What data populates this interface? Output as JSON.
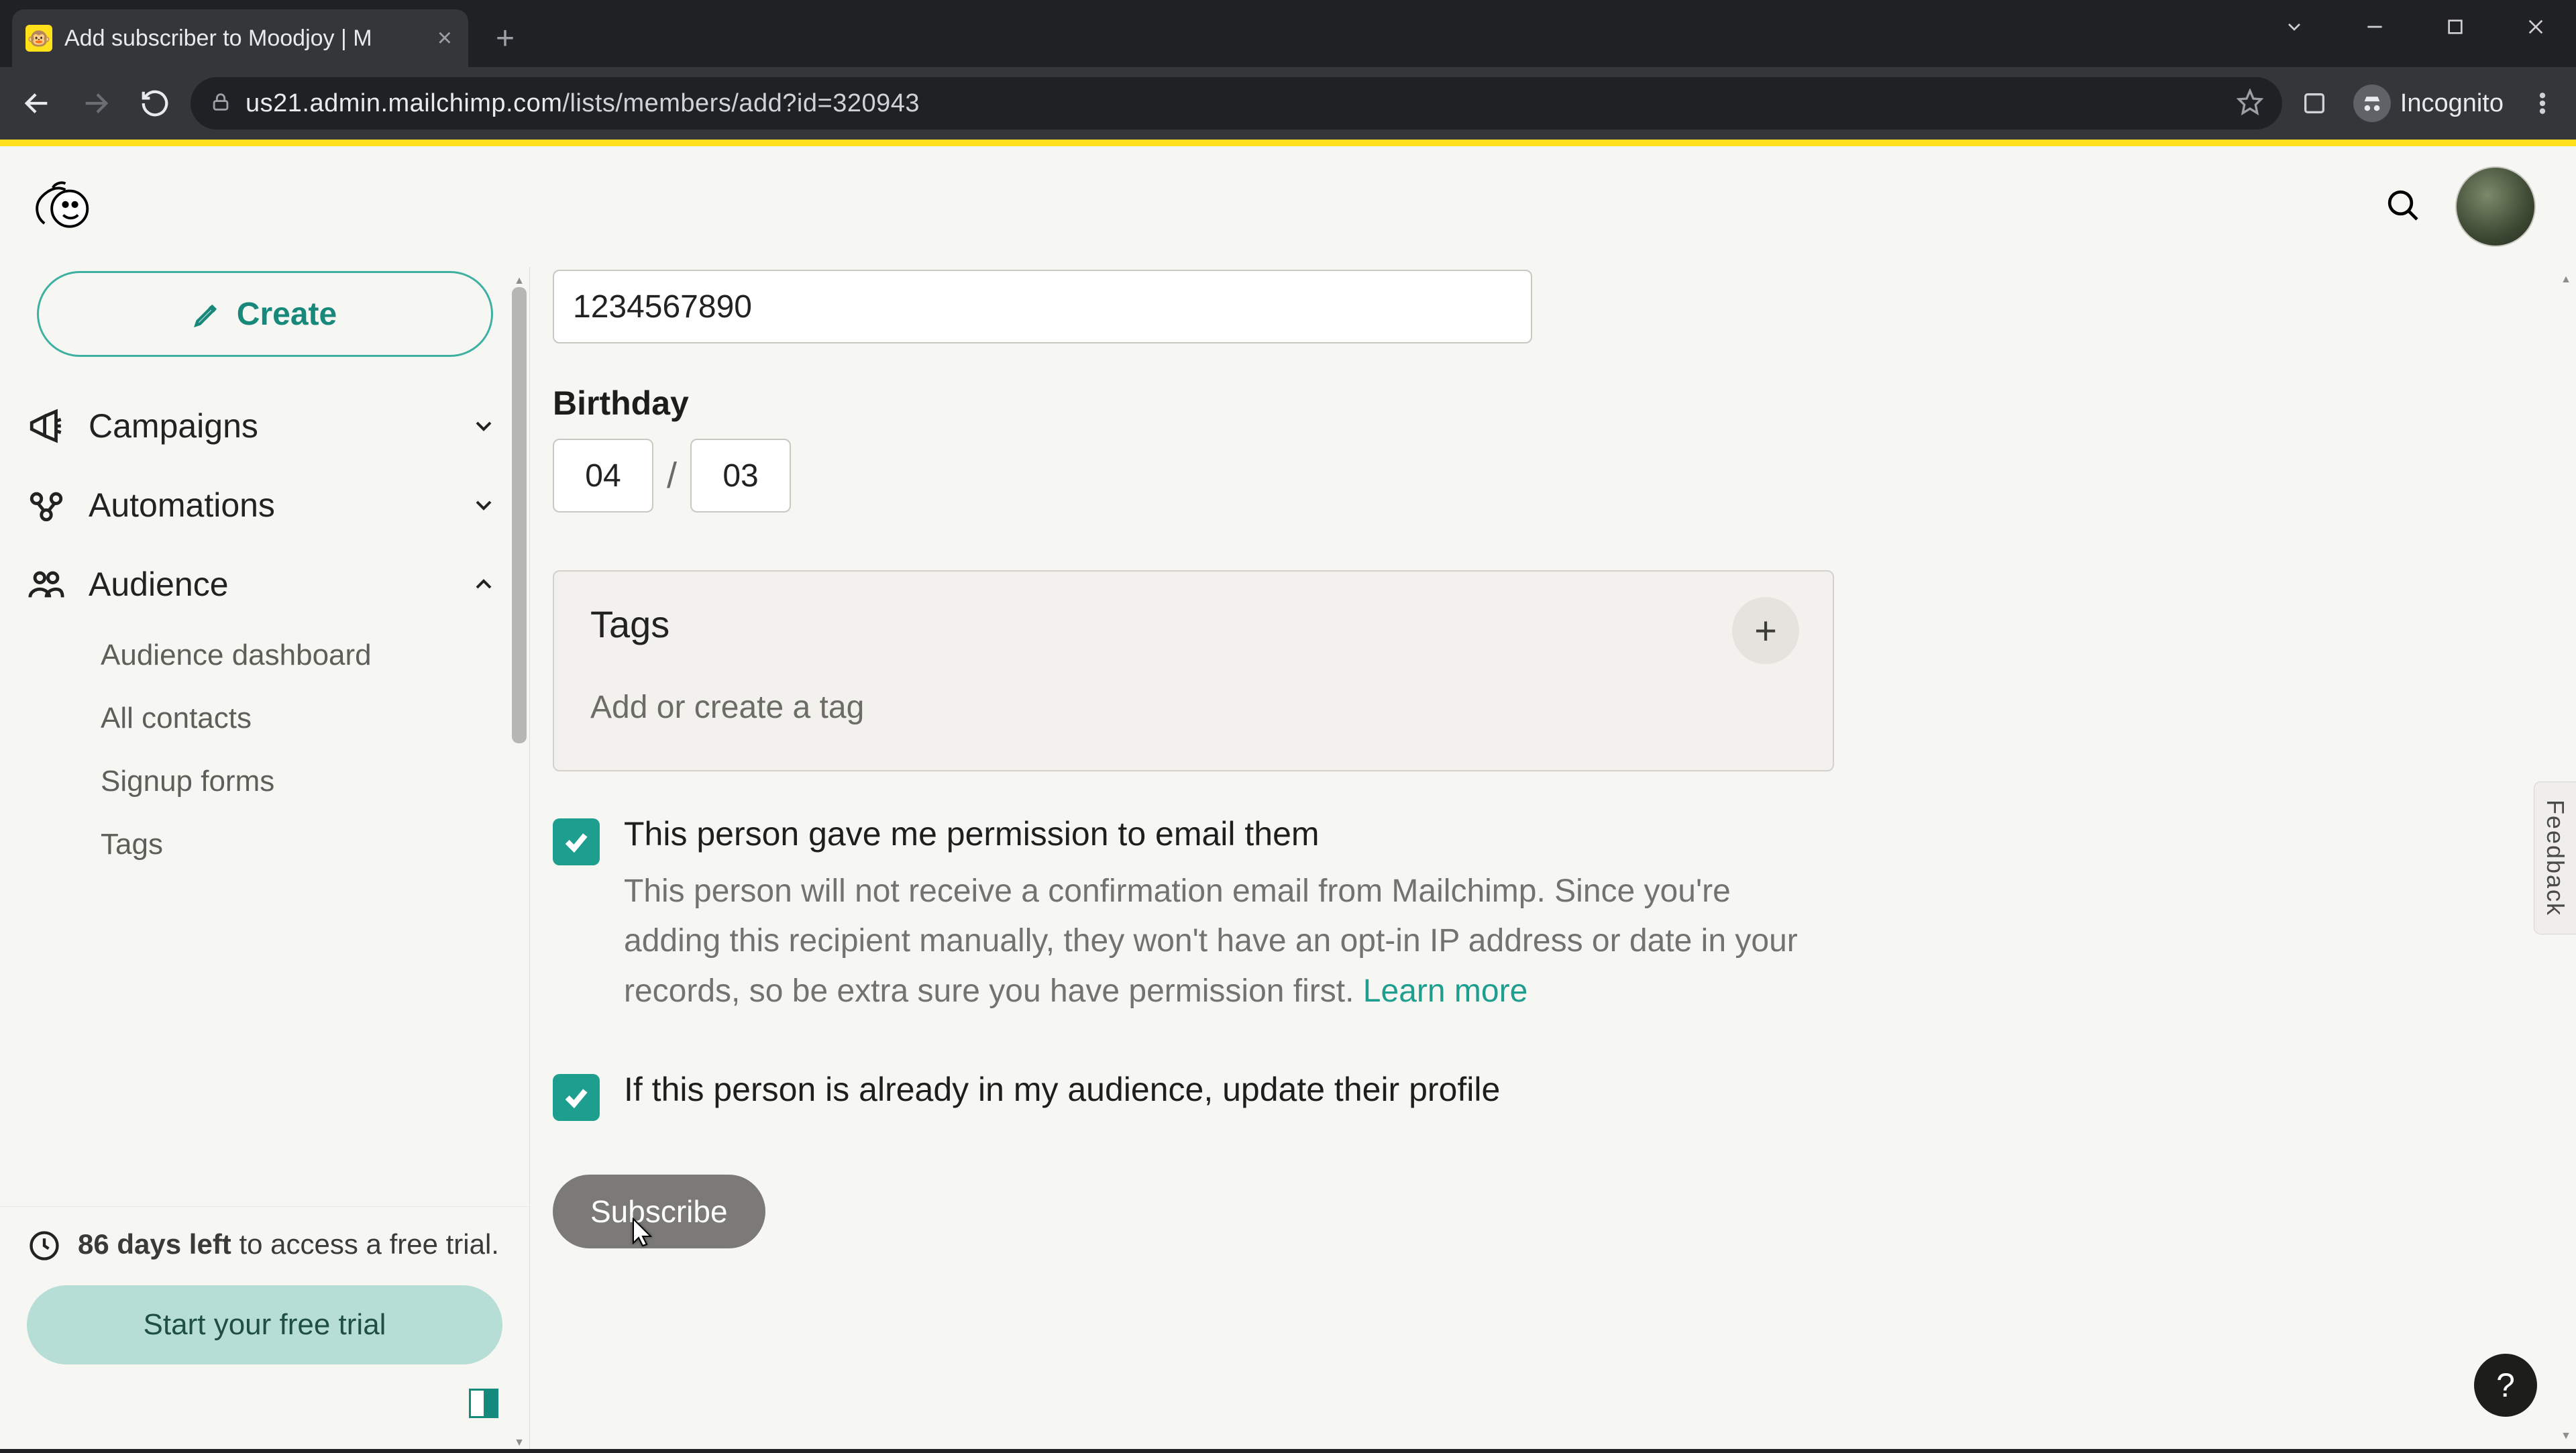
{
  "browser": {
    "tab_title": "Add subscriber to Moodjoy | M",
    "incognito_label": "Incognito",
    "url_host": "us21.admin.mailchimp.com",
    "url_path": "/lists/members/add?id=320943"
  },
  "sidebar": {
    "create_label": "Create",
    "items": [
      {
        "label": "Campaigns",
        "expanded": false
      },
      {
        "label": "Automations",
        "expanded": false
      },
      {
        "label": "Audience",
        "expanded": true
      }
    ],
    "audience_subitems": [
      "Audience dashboard",
      "All contacts",
      "Signup forms",
      "Tags"
    ],
    "trial_days_bold": "86 days left",
    "trial_days_rest": " to access a free trial.",
    "trial_button": "Start your free trial"
  },
  "form": {
    "phone_value": "1234567890",
    "birthday_label": "Birthday",
    "birthday_month": "04",
    "birthday_day": "03",
    "tags_title": "Tags",
    "tags_hint": "Add or create a tag",
    "permission_title": "This person gave me permission to email them",
    "permission_desc": "This person will not receive a confirmation email from Mailchimp. Since you're adding this recipient manually, they won't have an opt-in IP address or date in your records, so be extra sure you have permission first. ",
    "permission_learn_more": "Learn more",
    "update_profile_title": "If this person is already in my audience, update their profile",
    "subscribe_label": "Subscribe"
  },
  "misc": {
    "feedback_label": "Feedback",
    "help_label": "?"
  }
}
